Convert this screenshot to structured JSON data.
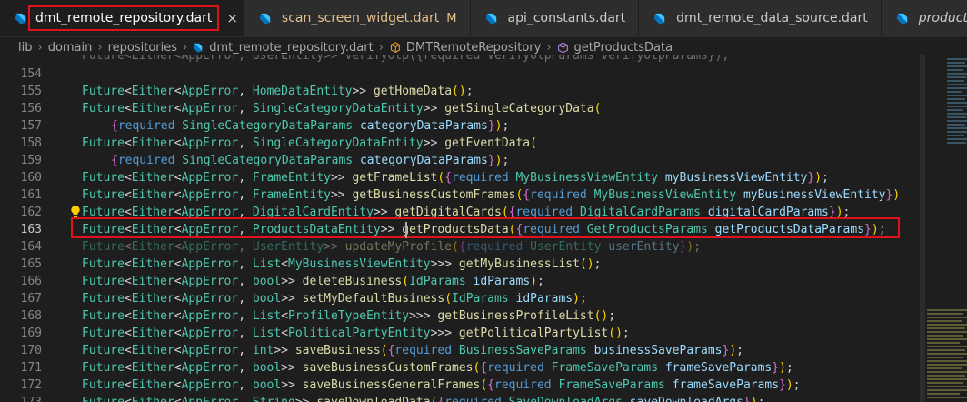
{
  "tabs": [
    {
      "label": "dmt_remote_repository.dart",
      "active": true,
      "has_close": true
    },
    {
      "label": "scan_screen_widget.dart",
      "modified_badge": "M"
    },
    {
      "label": "api_constants.dart"
    },
    {
      "label": "dmt_remote_data_source.dart"
    },
    {
      "label": "products_data_entity.dart"
    }
  ],
  "close_glyph": "×",
  "breadcrumb": [
    "lib",
    "domain",
    "repositories",
    "dmt_remote_repository.dart",
    "DMTRemoteRepository",
    "getProductsData"
  ],
  "breadcrumb_sep": "›",
  "colors": {
    "accent_highlight": "#e0121b",
    "type": "#4ec9b0",
    "function": "#dcdcaa",
    "keyword": "#569cd6",
    "parameter": "#9cdcfe"
  },
  "top_partial_line": "Future<Either<AppError, UserEntity>> verifyOtp({required VerifyOtpParams verifyOtpParams});",
  "lines": [
    {
      "n": "154",
      "segs": []
    },
    {
      "n": "155",
      "segs": [
        [
          "type",
          "Future"
        ],
        [
          "p",
          "<"
        ],
        [
          "type",
          "Either"
        ],
        [
          "p",
          "<"
        ],
        [
          "type",
          "AppError"
        ],
        [
          "p",
          ", "
        ],
        [
          "type",
          "HomeDataEntity"
        ],
        [
          "p",
          ">> "
        ],
        [
          "fn",
          "getHomeData"
        ],
        [
          "br",
          "()"
        ],
        [
          "p",
          ";"
        ]
      ]
    },
    {
      "n": "156",
      "segs": [
        [
          "type",
          "Future"
        ],
        [
          "p",
          "<"
        ],
        [
          "type",
          "Either"
        ],
        [
          "p",
          "<"
        ],
        [
          "type",
          "AppError"
        ],
        [
          "p",
          ", "
        ],
        [
          "type",
          "SingleCategoryDataEntity"
        ],
        [
          "p",
          ">> "
        ],
        [
          "fn",
          "getSingleCategoryData"
        ],
        [
          "br",
          "("
        ]
      ]
    },
    {
      "n": "157",
      "indent": true,
      "segs": [
        [
          "br2",
          "{"
        ],
        [
          "kw",
          "required "
        ],
        [
          "type",
          "SingleCategoryDataParams "
        ],
        [
          "param",
          "categoryDataParams"
        ],
        [
          "br2",
          "}"
        ],
        [
          "br",
          ")"
        ],
        [
          "p",
          ";"
        ]
      ]
    },
    {
      "n": "158",
      "segs": [
        [
          "type",
          "Future"
        ],
        [
          "p",
          "<"
        ],
        [
          "type",
          "Either"
        ],
        [
          "p",
          "<"
        ],
        [
          "type",
          "AppError"
        ],
        [
          "p",
          ", "
        ],
        [
          "type",
          "SingleCategoryDataEntity"
        ],
        [
          "p",
          ">> "
        ],
        [
          "fn",
          "getEventData"
        ],
        [
          "br",
          "("
        ]
      ]
    },
    {
      "n": "159",
      "indent": true,
      "segs": [
        [
          "br2",
          "{"
        ],
        [
          "kw",
          "required "
        ],
        [
          "type",
          "SingleCategoryDataParams "
        ],
        [
          "param",
          "categoryDataParams"
        ],
        [
          "br2",
          "}"
        ],
        [
          "br",
          ")"
        ],
        [
          "p",
          ";"
        ]
      ]
    },
    {
      "n": "160",
      "segs": [
        [
          "type",
          "Future"
        ],
        [
          "p",
          "<"
        ],
        [
          "type",
          "Either"
        ],
        [
          "p",
          "<"
        ],
        [
          "type",
          "AppError"
        ],
        [
          "p",
          ", "
        ],
        [
          "type",
          "FrameEntity"
        ],
        [
          "p",
          ">> "
        ],
        [
          "fn",
          "getFrameList"
        ],
        [
          "br",
          "("
        ],
        [
          "br2",
          "{"
        ],
        [
          "kw",
          "required "
        ],
        [
          "type",
          "MyBusinessViewEntity "
        ],
        [
          "param",
          "myBusinessViewEntity"
        ],
        [
          "br2",
          "}"
        ],
        [
          "br",
          ")"
        ],
        [
          "p",
          ";"
        ]
      ]
    },
    {
      "n": "161",
      "segs": [
        [
          "type",
          "Future"
        ],
        [
          "p",
          "<"
        ],
        [
          "type",
          "Either"
        ],
        [
          "p",
          "<"
        ],
        [
          "type",
          "AppError"
        ],
        [
          "p",
          ", "
        ],
        [
          "type",
          "FrameEntity"
        ],
        [
          "p",
          ">> "
        ],
        [
          "fn",
          "getBusinessCustomFrames"
        ],
        [
          "br",
          "("
        ],
        [
          "br2",
          "{"
        ],
        [
          "kw",
          "required "
        ],
        [
          "type",
          "MyBusinessViewEntity "
        ],
        [
          "param",
          "myBusinessViewEntity"
        ],
        [
          "br2",
          "}"
        ],
        [
          "br",
          ")"
        ]
      ]
    },
    {
      "n": "162",
      "bulb": true,
      "segs": [
        [
          "type",
          "Future"
        ],
        [
          "p",
          "<"
        ],
        [
          "type",
          "Either"
        ],
        [
          "p",
          "<"
        ],
        [
          "type",
          "AppError"
        ],
        [
          "p",
          ", "
        ],
        [
          "type",
          "DigitalCardEntity"
        ],
        [
          "p",
          ">> "
        ],
        [
          "fn",
          "getDigitalCards"
        ],
        [
          "br",
          "("
        ],
        [
          "br2",
          "{"
        ],
        [
          "kw",
          "required "
        ],
        [
          "type",
          "DigitalCardParams "
        ],
        [
          "param",
          "digitalCardParams"
        ],
        [
          "br2",
          "}"
        ],
        [
          "br",
          ")"
        ],
        [
          "p",
          ";"
        ]
      ]
    },
    {
      "n": "163",
      "current": true,
      "segs": [
        [
          "type",
          "Future"
        ],
        [
          "p",
          "<"
        ],
        [
          "type",
          "Either"
        ],
        [
          "p",
          "<"
        ],
        [
          "type",
          "AppError"
        ],
        [
          "p",
          ", "
        ],
        [
          "type",
          "ProductsDataEntity"
        ],
        [
          "p",
          ">> "
        ],
        [
          "fn",
          "getProductsData"
        ],
        [
          "br",
          "("
        ],
        [
          "br2",
          "{"
        ],
        [
          "kw",
          "required "
        ],
        [
          "type",
          "GetProductsParams "
        ],
        [
          "param",
          "getProductsDataParams"
        ],
        [
          "br2",
          "}"
        ],
        [
          "br",
          ")"
        ],
        [
          "p",
          ";"
        ]
      ]
    },
    {
      "n": "164",
      "faded": true,
      "segs": [
        [
          "type",
          "Future"
        ],
        [
          "p",
          "<"
        ],
        [
          "type",
          "Either"
        ],
        [
          "p",
          "<"
        ],
        [
          "type",
          "AppError"
        ],
        [
          "p",
          ", "
        ],
        [
          "type",
          "UserEntity"
        ],
        [
          "p",
          ">> "
        ],
        [
          "fn",
          "updateMyProfile"
        ],
        [
          "br",
          "("
        ],
        [
          "br2",
          "{"
        ],
        [
          "kw",
          "required "
        ],
        [
          "type",
          "UserEntity "
        ],
        [
          "param",
          "userEntity"
        ],
        [
          "br2",
          "}"
        ],
        [
          "br",
          ")"
        ],
        [
          "p",
          ";"
        ]
      ]
    },
    {
      "n": "165",
      "segs": [
        [
          "type",
          "Future"
        ],
        [
          "p",
          "<"
        ],
        [
          "type",
          "Either"
        ],
        [
          "p",
          "<"
        ],
        [
          "type",
          "AppError"
        ],
        [
          "p",
          ", "
        ],
        [
          "type",
          "List"
        ],
        [
          "p",
          "<"
        ],
        [
          "type",
          "MyBusinessViewEntity"
        ],
        [
          "p",
          ">>> "
        ],
        [
          "fn",
          "getMyBusinessList"
        ],
        [
          "br",
          "()"
        ],
        [
          "p",
          ";"
        ]
      ]
    },
    {
      "n": "166",
      "segs": [
        [
          "type",
          "Future"
        ],
        [
          "p",
          "<"
        ],
        [
          "type",
          "Either"
        ],
        [
          "p",
          "<"
        ],
        [
          "type",
          "AppError"
        ],
        [
          "p",
          ", "
        ],
        [
          "type",
          "bool"
        ],
        [
          "p",
          ">> "
        ],
        [
          "fn",
          "deleteBusiness"
        ],
        [
          "br",
          "("
        ],
        [
          "type",
          "IdParams "
        ],
        [
          "param",
          "idParams"
        ],
        [
          "br",
          ")"
        ],
        [
          "p",
          ";"
        ]
      ]
    },
    {
      "n": "167",
      "segs": [
        [
          "type",
          "Future"
        ],
        [
          "p",
          "<"
        ],
        [
          "type",
          "Either"
        ],
        [
          "p",
          "<"
        ],
        [
          "type",
          "AppError"
        ],
        [
          "p",
          ", "
        ],
        [
          "type",
          "bool"
        ],
        [
          "p",
          ">> "
        ],
        [
          "fn",
          "setMyDefaultBusiness"
        ],
        [
          "br",
          "("
        ],
        [
          "type",
          "IdParams "
        ],
        [
          "param",
          "idParams"
        ],
        [
          "br",
          ")"
        ],
        [
          "p",
          ";"
        ]
      ]
    },
    {
      "n": "168",
      "segs": [
        [
          "type",
          "Future"
        ],
        [
          "p",
          "<"
        ],
        [
          "type",
          "Either"
        ],
        [
          "p",
          "<"
        ],
        [
          "type",
          "AppError"
        ],
        [
          "p",
          ", "
        ],
        [
          "type",
          "List"
        ],
        [
          "p",
          "<"
        ],
        [
          "type",
          "ProfileTypeEntity"
        ],
        [
          "p",
          ">>> "
        ],
        [
          "fn",
          "getBusinessProfileList"
        ],
        [
          "br",
          "()"
        ],
        [
          "p",
          ";"
        ]
      ]
    },
    {
      "n": "169",
      "segs": [
        [
          "type",
          "Future"
        ],
        [
          "p",
          "<"
        ],
        [
          "type",
          "Either"
        ],
        [
          "p",
          "<"
        ],
        [
          "type",
          "AppError"
        ],
        [
          "p",
          ", "
        ],
        [
          "type",
          "List"
        ],
        [
          "p",
          "<"
        ],
        [
          "type",
          "PoliticalPartyEntity"
        ],
        [
          "p",
          ">>> "
        ],
        [
          "fn",
          "getPoliticalPartyList"
        ],
        [
          "br",
          "()"
        ],
        [
          "p",
          ";"
        ]
      ]
    },
    {
      "n": "170",
      "segs": [
        [
          "type",
          "Future"
        ],
        [
          "p",
          "<"
        ],
        [
          "type",
          "Either"
        ],
        [
          "p",
          "<"
        ],
        [
          "type",
          "AppError"
        ],
        [
          "p",
          ", "
        ],
        [
          "type",
          "int"
        ],
        [
          "p",
          ">> "
        ],
        [
          "fn",
          "saveBusiness"
        ],
        [
          "br",
          "("
        ],
        [
          "br2",
          "{"
        ],
        [
          "kw",
          "required "
        ],
        [
          "type",
          "BusinessSaveParams "
        ],
        [
          "param",
          "businessSaveParams"
        ],
        [
          "br2",
          "}"
        ],
        [
          "br",
          ")"
        ],
        [
          "p",
          ";"
        ]
      ]
    },
    {
      "n": "171",
      "segs": [
        [
          "type",
          "Future"
        ],
        [
          "p",
          "<"
        ],
        [
          "type",
          "Either"
        ],
        [
          "p",
          "<"
        ],
        [
          "type",
          "AppError"
        ],
        [
          "p",
          ", "
        ],
        [
          "type",
          "bool"
        ],
        [
          "p",
          ">> "
        ],
        [
          "fn",
          "saveBusinessCustomFrames"
        ],
        [
          "br",
          "("
        ],
        [
          "br2",
          "{"
        ],
        [
          "kw",
          "required "
        ],
        [
          "type",
          "FrameSaveParams "
        ],
        [
          "param",
          "frameSaveParams"
        ],
        [
          "br2",
          "}"
        ],
        [
          "br",
          ")"
        ],
        [
          "p",
          ";"
        ]
      ]
    },
    {
      "n": "172",
      "segs": [
        [
          "type",
          "Future"
        ],
        [
          "p",
          "<"
        ],
        [
          "type",
          "Either"
        ],
        [
          "p",
          "<"
        ],
        [
          "type",
          "AppError"
        ],
        [
          "p",
          ", "
        ],
        [
          "type",
          "bool"
        ],
        [
          "p",
          ">> "
        ],
        [
          "fn",
          "saveBusinessGeneralFrames"
        ],
        [
          "br",
          "("
        ],
        [
          "br2",
          "{"
        ],
        [
          "kw",
          "required "
        ],
        [
          "type",
          "FrameSaveParams "
        ],
        [
          "param",
          "frameSaveParams"
        ],
        [
          "br2",
          "}"
        ],
        [
          "br",
          ")"
        ],
        [
          "p",
          ";"
        ]
      ]
    },
    {
      "n": "173",
      "segs": [
        [
          "type",
          "Future"
        ],
        [
          "p",
          "<"
        ],
        [
          "type",
          "Either"
        ],
        [
          "p",
          "<"
        ],
        [
          "type",
          "AppError"
        ],
        [
          "p",
          ", "
        ],
        [
          "type",
          "String"
        ],
        [
          "p",
          ">> "
        ],
        [
          "fn",
          "saveDownloadData"
        ],
        [
          "br",
          "("
        ],
        [
          "br2",
          "{"
        ],
        [
          "kw",
          "required "
        ],
        [
          "type",
          "SaveDownloadArgs "
        ],
        [
          "param",
          "saveDownloadArgs"
        ],
        [
          "br2",
          "}"
        ],
        [
          "br",
          ")"
        ],
        [
          "p",
          ";"
        ]
      ]
    }
  ]
}
